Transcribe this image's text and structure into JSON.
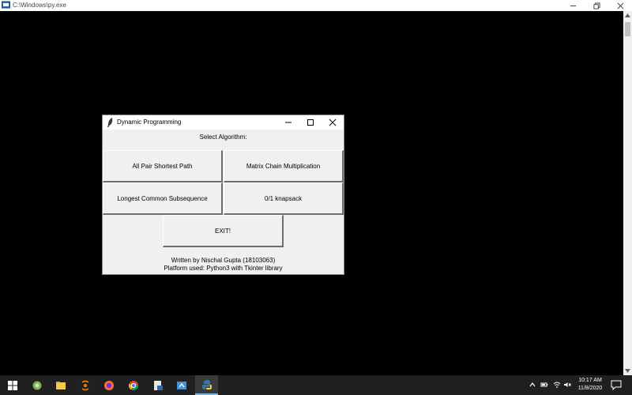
{
  "console": {
    "title": "C:\\Windows\\py.exe"
  },
  "dialog": {
    "title": "Dynamic Programming",
    "heading": "Select Algorithm:",
    "buttons": {
      "apsp": "All Pair Shortest Path",
      "mcm": "Matrix Chain Multiplication",
      "lcs": "Longest Common Subsequence",
      "knapsack": "0/1 knapsack",
      "exit": "EXIT!"
    },
    "footer": {
      "author": "Written by Nischal Gupta (18103063)",
      "platform": "Platform used: Python3 with Tkinter library"
    }
  },
  "taskbar": {
    "apps": [
      "windows-start-icon",
      "app-icon",
      "file-explorer-icon",
      "app-icon",
      "firefox-icon",
      "chrome-icon",
      "app-icon",
      "app-icon",
      "python-icon"
    ],
    "clock": {
      "time": "10:17 AM",
      "date": "11/8/2020"
    }
  },
  "colors": {
    "desktop": "#000000",
    "taskbar": "#202020",
    "dialog_bg": "#f0f0f0",
    "accent": "#76b9ed"
  }
}
